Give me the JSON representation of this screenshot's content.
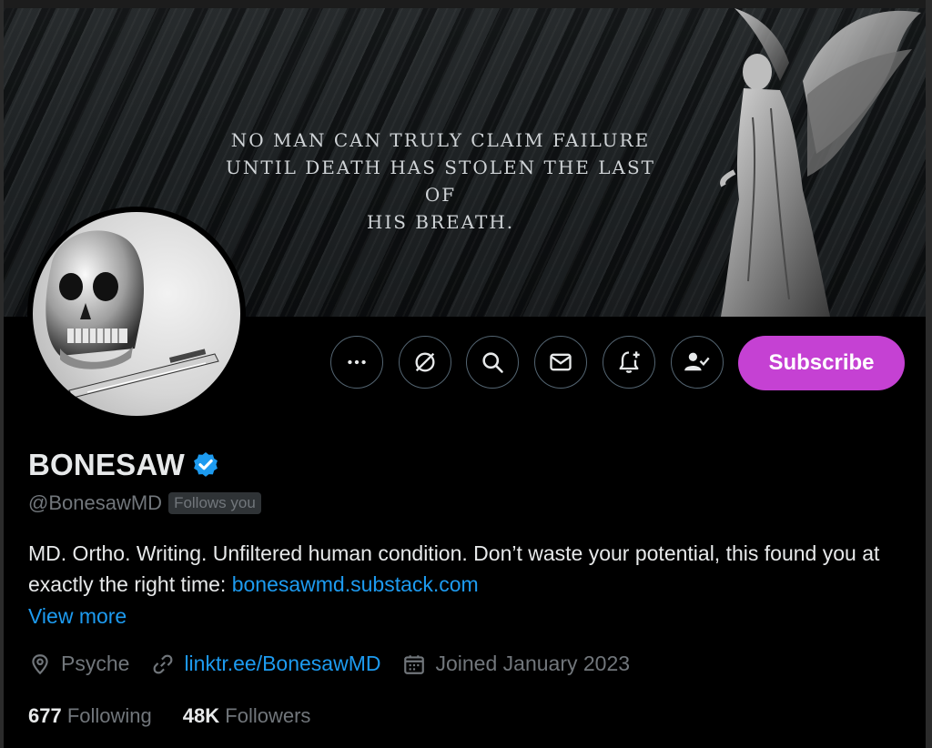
{
  "banner": {
    "quote_line1": "No man can truly claim failure",
    "quote_line2": "until death has stolen the last of",
    "quote_line3": "his breath."
  },
  "actions": {
    "more_icon": "more-horizontal-icon",
    "grok_icon": "grok-icon",
    "search_icon": "search-icon",
    "message_icon": "envelope-icon",
    "notify_icon": "bell-plus-icon",
    "following_icon": "person-check-icon",
    "subscribe_label": "Subscribe",
    "subscribe_color": "#c541d3"
  },
  "profile": {
    "name": "BONESAW",
    "verified_color": "#1d9bf0",
    "handle": "@BonesawMD",
    "follows_you": "Follows you",
    "bio_text": "MD. Ortho. Writing. Unfiltered human condition.  Don’t waste your potential, this found you at exactly the right time: ",
    "bio_link": "bonesawmd.substack.com",
    "view_more": "View more",
    "location": "Psyche",
    "website": "linktr.ee/BonesawMD",
    "joined": "Joined January 2023",
    "following_count": "677",
    "following_label": "Following",
    "followers_count": "48K",
    "followers_label": "Followers"
  },
  "colors": {
    "link": "#1d9bf0",
    "muted": "#71767b",
    "text": "#e7e9ea",
    "background": "#000000"
  }
}
